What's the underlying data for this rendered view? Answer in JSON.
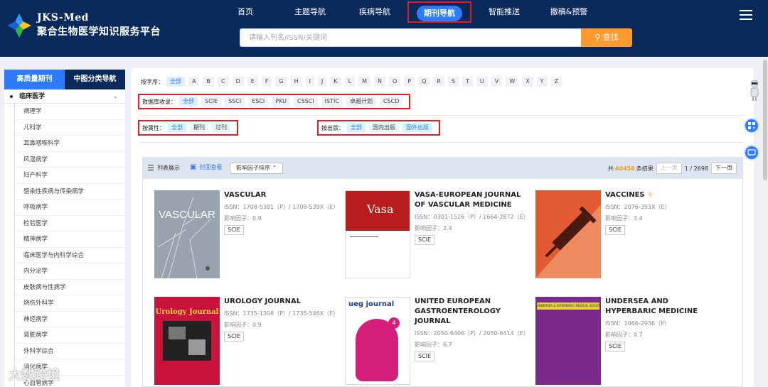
{
  "brand": {
    "en": "JKS-Med",
    "cn": "聚合生物医学知识服务平台"
  },
  "nav": [
    {
      "label": "首页"
    },
    {
      "label": "主题导航"
    },
    {
      "label": "疾病导航"
    },
    {
      "label": "期刊导航",
      "active": true
    },
    {
      "label": "智能推送"
    },
    {
      "label": "撤稿&预警"
    }
  ],
  "search": {
    "placeholder": "请输入刊名/ISSN/关键词",
    "button": "查找"
  },
  "sidebar": {
    "tabs": [
      "高质量期刊",
      "中图分类导航"
    ],
    "category": "临床医学",
    "items": [
      "病理学",
      "儿科学",
      "耳鼻咽喉科学",
      "风湿病学",
      "妇产科学",
      "感染性疾病与传染病学",
      "呼吸病学",
      "检验医学",
      "精神病学",
      "临床医学与内科学综合",
      "内分泌学",
      "皮肤病与性病学",
      "烧伤外科学",
      "神经病学",
      "肾脏病学",
      "外科学综合",
      "消化病学",
      "心血管病学"
    ]
  },
  "filters": {
    "letters_label": "按字序：",
    "letters": [
      "全部",
      "A",
      "B",
      "C",
      "D",
      "E",
      "F",
      "G",
      "H",
      "I",
      "J",
      "K",
      "L",
      "M",
      "N",
      "O",
      "P",
      "Q",
      "R",
      "S",
      "T",
      "U",
      "V",
      "W",
      "X",
      "Y",
      "Z"
    ],
    "db_label": "数据库收录：",
    "db": [
      "全部",
      "SCIE",
      "SSCI",
      "ESCI",
      "PKU",
      "CSSCI",
      "ISTIC",
      "卓越计划",
      "CSCD"
    ],
    "attr_label": "按属性：",
    "attr": [
      "全部",
      "期刊",
      "过刊"
    ],
    "pub_label": "按出版：",
    "pub": [
      "全部",
      "国内出版",
      "国外出版"
    ]
  },
  "toolbar": {
    "list_view": "列表展示",
    "cover_view": "封面查看",
    "sort": "影响因子排序",
    "total_prefix": "共",
    "total": "40456",
    "total_suffix": "条结果",
    "prev": "上一页",
    "page": "1 / 2698",
    "next": "下一页"
  },
  "journals": [
    {
      "title": "VASCULAR",
      "issn": "ISSN：1708-5381（P）/ 1708-539X（E）",
      "if": "影响因子：0.9",
      "tag": "SCIE",
      "cover_text": "VASCULAR",
      "cover_color": "#9aa3ad"
    },
    {
      "title": "VASA-EUROPEAN JOURNAL OF VASCULAR MEDICINE",
      "issn": "ISSN：0301-1526（P）/ 1664-2872（E）",
      "if": "影响因子：2.4",
      "tag": "SCIE",
      "cover_text": "Vasa",
      "cover_color": "#b81d1d"
    },
    {
      "title": "VACCINES",
      "issn": "ISSN：2076-393X（E）",
      "if": "影响因子：3.4",
      "tag": "SCIE",
      "cover_text": "",
      "cover_color": "#e8704a"
    },
    {
      "title": "UROLOGY JOURNAL",
      "issn": "ISSN：1735-1308（P）/ 1735-546X（E）",
      "if": "影响因子：0.9",
      "tag": "SCIE",
      "cover_text": "Urology Journal",
      "cover_color": "#c8143c"
    },
    {
      "title": "UNITED EUROPEAN GASTROENTEROLOGY JOURNAL",
      "issn": "ISSN：2050-6406（P）/ 2050-6414（E）",
      "if": "影响因子：6.7",
      "tag": "SCIE",
      "cover_text": "ueg journal",
      "cover_color": "#d4207a"
    },
    {
      "title": "UNDERSEA AND HYPERBARIC MEDICINE",
      "issn": "ISSN：1066-2936（P）",
      "if": "影响因子：0.7",
      "tag": "SCIE",
      "cover_text": "UNDERSEA & HYPERBARIC MEDICAL SOCIETY",
      "cover_color": "#7a2a8a"
    }
  ],
  "watermark": "大数跨境"
}
